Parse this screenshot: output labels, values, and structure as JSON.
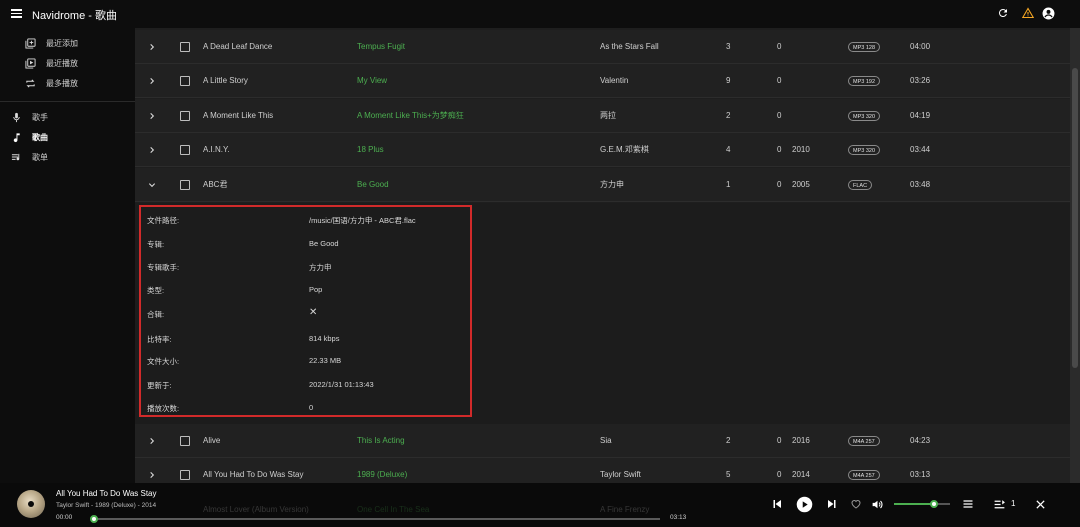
{
  "app": {
    "title": "Navidrome - 歌曲"
  },
  "sidebar": {
    "items": [
      {
        "label": "最近添加",
        "icon": "library-add-icon"
      },
      {
        "label": "最近播放",
        "icon": "recent-play-icon"
      },
      {
        "label": "最多播放",
        "icon": "repeat-icon"
      },
      {
        "label": "歌手",
        "icon": "microphone-icon"
      },
      {
        "label": "歌曲",
        "icon": "music-note-icon",
        "active": true
      },
      {
        "label": "歌单",
        "icon": "playlist-icon"
      }
    ]
  },
  "songs": [
    {
      "title": "A Dead Leaf Dance",
      "album": "Tempus Fugit",
      "artist": "As the Stars Fall",
      "track": "3",
      "plays": "0",
      "year": "",
      "format": "MP3 128",
      "duration": "04:00",
      "expanded": false
    },
    {
      "title": "A Little Story",
      "album": "My View",
      "artist": "Valentin",
      "track": "9",
      "plays": "0",
      "year": "",
      "format": "MP3 192",
      "duration": "03:26",
      "expanded": false
    },
    {
      "title": "A Moment Like This",
      "album": "A Moment Like This+为梦痴狂",
      "artist": "两拉",
      "track": "2",
      "plays": "0",
      "year": "",
      "format": "MP3 320",
      "duration": "04:19",
      "expanded": false
    },
    {
      "title": "A.I.N.Y.",
      "album": "18 Plus",
      "artist": "G.E.M.邓紫棋",
      "track": "4",
      "plays": "0",
      "year": "2010",
      "format": "MP3 320",
      "duration": "03:44",
      "expanded": false
    },
    {
      "title": "ABC君",
      "album": "Be Good",
      "artist": "方力申",
      "track": "1",
      "plays": "0",
      "year": "2005",
      "format": "FLAC",
      "duration": "03:48",
      "expanded": true
    },
    {
      "title": "Alive",
      "album": "This Is Acting",
      "artist": "Sia",
      "track": "2",
      "plays": "0",
      "year": "2016",
      "format": "M4A 257",
      "duration": "04:23",
      "expanded": false
    },
    {
      "title": "All You Had To Do Was Stay",
      "album": "1989 (Deluxe)",
      "artist": "Taylor Swift",
      "track": "5",
      "plays": "0",
      "year": "2014",
      "format": "M4A 257",
      "duration": "03:13",
      "expanded": false
    },
    {
      "title": "Almost Lover (Album Version)",
      "album": "One Cell In The Sea",
      "artist": "A Fine Frenzy",
      "track": "",
      "plays": "",
      "year": "",
      "format": "",
      "duration": "",
      "expanded": false
    }
  ],
  "detail": {
    "rows": [
      {
        "key": "文件路径:",
        "value": "/music/国语/方力申 - ABC君.flac"
      },
      {
        "key": "专辑:",
        "value": "Be Good"
      },
      {
        "key": "专辑歌手:",
        "value": "方力申"
      },
      {
        "key": "类型:",
        "value": "Pop"
      },
      {
        "key": "合辑:",
        "value": "✕"
      },
      {
        "key": "比特率:",
        "value": "814 kbps"
      },
      {
        "key": "文件大小:",
        "value": "22.33 MB"
      },
      {
        "key": "更新于:",
        "value": "2022/1/31 01:13:43"
      },
      {
        "key": "播放次数:",
        "value": "0"
      }
    ]
  },
  "player": {
    "title": "All You Had To Do Was Stay",
    "subtitle": "Taylor Swift - 1989 (Deluxe) - 2014",
    "elapsed": "00:00",
    "total": "03:13",
    "progress": 0.0,
    "volume": 0.72,
    "queue_count": "1"
  },
  "colors": {
    "accent": "#4caf50",
    "highlight_border": "#d12a2a",
    "warning": "#f5a623"
  }
}
